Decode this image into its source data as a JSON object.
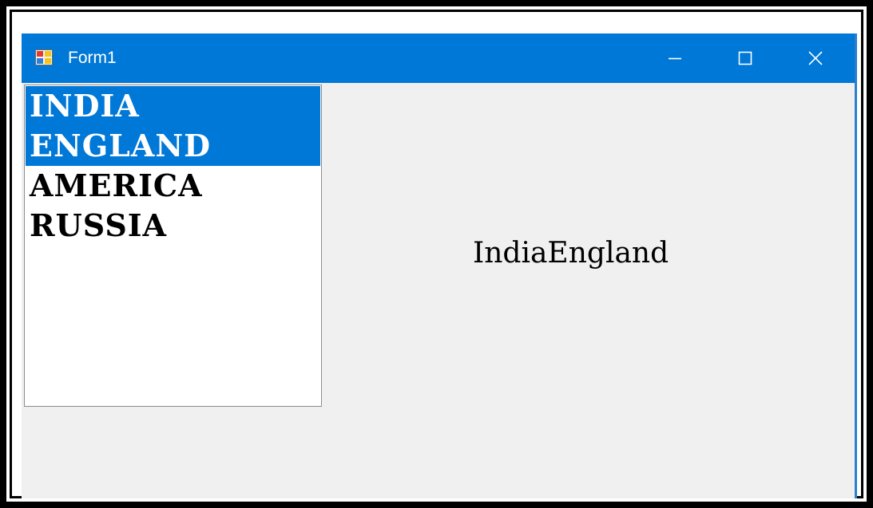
{
  "window": {
    "title": "Form1",
    "icon": "winforms-app-icon",
    "accent_color": "#0078d7",
    "controls": {
      "minimize_icon": "minimize-icon",
      "maximize_icon": "maximize-icon",
      "close_icon": "close-icon"
    }
  },
  "listbox": {
    "items": [
      {
        "label": "INDIA",
        "selected": true
      },
      {
        "label": "ENGLAND",
        "selected": true
      },
      {
        "label": "AMERICA",
        "selected": false
      },
      {
        "label": "RUSSIA",
        "selected": false
      }
    ],
    "selection_color": "#0078d7"
  },
  "result": {
    "text": "IndiaEngland"
  }
}
